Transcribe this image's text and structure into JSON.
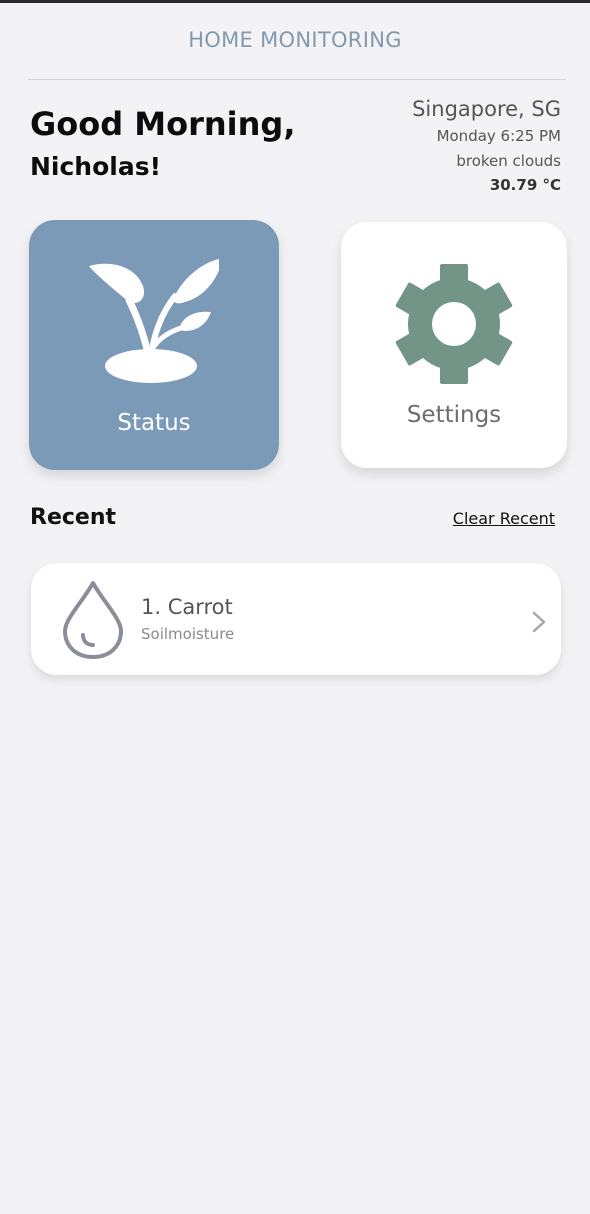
{
  "header": {
    "title": "HOME MONITORING"
  },
  "greeting": {
    "line1": "Good Morning,",
    "line2": "Nicholas!"
  },
  "weather": {
    "city": "Singapore, SG",
    "datetime": "Monday 6:25 PM",
    "description": "broken clouds",
    "temperature": "30.79 °C"
  },
  "tiles": {
    "status": {
      "label": "Status",
      "icon": "plant-icon",
      "color": "#7b9ab7"
    },
    "settings": {
      "label": "Settings",
      "icon": "gear-icon",
      "icon_color": "#729588"
    }
  },
  "recent": {
    "title": "Recent",
    "clear_label": "Clear Recent",
    "items": [
      {
        "title": "1. Carrot",
        "subtitle": "Soilmoisture",
        "icon": "water-drop-icon"
      }
    ]
  }
}
